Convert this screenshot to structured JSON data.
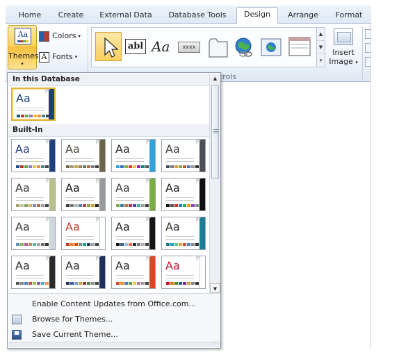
{
  "tabs": [
    {
      "label": "Home",
      "active": false
    },
    {
      "label": "Create",
      "active": false
    },
    {
      "label": "External Data",
      "active": false
    },
    {
      "label": "Database Tools",
      "active": false
    },
    {
      "label": "Design",
      "active": true
    },
    {
      "label": "Arrange",
      "active": false
    },
    {
      "label": "Format",
      "active": false
    }
  ],
  "ribbon": {
    "themes_label": "Themes",
    "colors_label": "Colors",
    "fonts_label": "Fonts",
    "insert_image_label_1": "Insert",
    "insert_image_label_2": "Image",
    "dropdown_glyph": "▾",
    "group_label_partial": "ntrols",
    "text_box_glyph": "abl",
    "label_glyph": "Aa",
    "button_glyph": "xxxx"
  },
  "themes_panel": {
    "section_in_database": "In this Database",
    "section_builtin": "Built-In",
    "current_theme": {
      "sample": "Aa",
      "font": "sans",
      "color": "#1f3f7a",
      "accent": "#1f3f7a",
      "palette": [
        "#1f4e8c",
        "#c0392b",
        "#6aa84f",
        "#8e7cc3",
        "#f1c232",
        "#e69138",
        "#45818e",
        "#444444"
      ]
    },
    "builtin_themes": [
      {
        "sample": "Aa",
        "font": "sans",
        "color": "#1f3f7a",
        "accent": "#1f3f7a",
        "palette": [
          "#1f4e8c",
          "#c0392b",
          "#6aa84f",
          "#8e7cc3",
          "#f1c232",
          "#e69138",
          "#45818e",
          "#444444"
        ]
      },
      {
        "sample": "Aa",
        "font": "sans",
        "color": "#4a4a3a",
        "accent": "#6b6448",
        "palette": [
          "#6b6448",
          "#a39c6d",
          "#c4a552",
          "#8a8a6a",
          "#5e7a66",
          "#9b6b4e",
          "#7a7a7a",
          "#444444"
        ]
      },
      {
        "sample": "Aa",
        "font": "sans",
        "color": "#2b2b2b",
        "accent": "#2fa4dc",
        "palette": [
          "#2fa4dc",
          "#3c6fb5",
          "#7cb342",
          "#e53935",
          "#fbc02d",
          "#8e24aa",
          "#00897b",
          "#555555"
        ]
      },
      {
        "sample": "Aa",
        "font": "sans",
        "color": "#3a3a3a",
        "accent": "#4d4d55",
        "palette": [
          "#4d4d55",
          "#7a7a88",
          "#d4a03a",
          "#8da24e",
          "#b55a3c",
          "#5a79a8",
          "#999999",
          "#333333"
        ]
      },
      {
        "sample": "Aa",
        "font": "sans",
        "color": "#3a3a3a",
        "accent": "#b9c08a",
        "palette": [
          "#a6a36a",
          "#c9c29b",
          "#8aa06a",
          "#d4b26a",
          "#7a8f9a",
          "#b56b4e",
          "#9a9a9a",
          "#444444"
        ]
      },
      {
        "sample": "Aa",
        "font": "sans",
        "color": "#111111",
        "accent": "#9a9a9a",
        "palette": [
          "#3a3a3a",
          "#777777",
          "#b5b5b5",
          "#5a7ea8",
          "#a84a4a",
          "#8aa84a",
          "#c9a13a",
          "#222222"
        ]
      },
      {
        "sample": "Aa",
        "font": "sans",
        "color": "#3a3a3a",
        "accent": "#7cae3c",
        "palette": [
          "#7cae3c",
          "#3c7cae",
          "#ae7c3c",
          "#ae3c5a",
          "#5a3cae",
          "#3cae9a",
          "#9a9a9a",
          "#444444"
        ]
      },
      {
        "sample": "Aa",
        "font": "sans",
        "color": "#222222",
        "accent": "#111111",
        "palette": [
          "#111111",
          "#555555",
          "#c0392b",
          "#2980b9",
          "#27ae60",
          "#f39c12",
          "#8e44ad",
          "#7f8c8d"
        ]
      },
      {
        "sample": "Aa",
        "font": "sans",
        "color": "#3a3a3a",
        "accent": "#cfd6dd",
        "palette": [
          "#5c8fb3",
          "#8fb35c",
          "#b35c8f",
          "#b38f5c",
          "#5cb3a3",
          "#a3a3a3",
          "#6b6b6b",
          "#333333"
        ]
      },
      {
        "sample": "Aa",
        "font": "sans",
        "color": "#c0392b",
        "accent": "#ffffff",
        "palette": [
          "#c0392b",
          "#e67e22",
          "#d35400",
          "#7f8c8d",
          "#16a085",
          "#2c3e50",
          "#95a5a6",
          "#444444"
        ]
      },
      {
        "sample": "Aa",
        "font": "sans",
        "color": "#222222",
        "accent": "#151515",
        "palette": [
          "#151515",
          "#3d5a80",
          "#98c1d9",
          "#ee6c4d",
          "#293241",
          "#7a7a7a",
          "#b0b0b0",
          "#444444"
        ]
      },
      {
        "sample": "Aa",
        "font": "sans",
        "color": "#2b2b2b",
        "accent": "#1a7d91",
        "palette": [
          "#1a7d91",
          "#26a3b8",
          "#6dbf8b",
          "#e0a33a",
          "#c0504d",
          "#4f81bd",
          "#8c8c8c",
          "#333333"
        ]
      },
      {
        "sample": "Aa",
        "font": "sans",
        "color": "#2b2b2b",
        "accent": "#2a2a2a",
        "palette": [
          "#555555",
          "#888888",
          "#4f81bd",
          "#c0504d",
          "#9bbb59",
          "#8064a2",
          "#4bacc6",
          "#f79646"
        ]
      },
      {
        "sample": "Aa",
        "font": "sans",
        "color": "#2b2b2b",
        "accent": "#1f2f5c",
        "palette": [
          "#1f2f5c",
          "#3c5a9a",
          "#7b9bd1",
          "#c9a13a",
          "#8a3c3c",
          "#4a7a4a",
          "#8a8a8a",
          "#444444"
        ]
      },
      {
        "sample": "Aa",
        "font": "sans",
        "color": "#2b2b2b",
        "accent": "#d64a1e",
        "palette": [
          "#d64a1e",
          "#f28e2b",
          "#4e79a7",
          "#59a14f",
          "#edc948",
          "#b07aa1",
          "#9c9c9c",
          "#444444"
        ]
      },
      {
        "sample": "Aa",
        "font": "sans",
        "color": "#c8102e",
        "accent": "#ffffff",
        "palette": [
          "#c8102e",
          "#e07a10",
          "#4a8a2a",
          "#2a5a9a",
          "#7a2a8a",
          "#c9a13a",
          "#8a8a8a",
          "#333333"
        ]
      }
    ],
    "commands": {
      "enable_updates": "Enable Content Updates from Office.com...",
      "browse": "Browse for Themes...",
      "save": "Save Current Theme..."
    }
  }
}
